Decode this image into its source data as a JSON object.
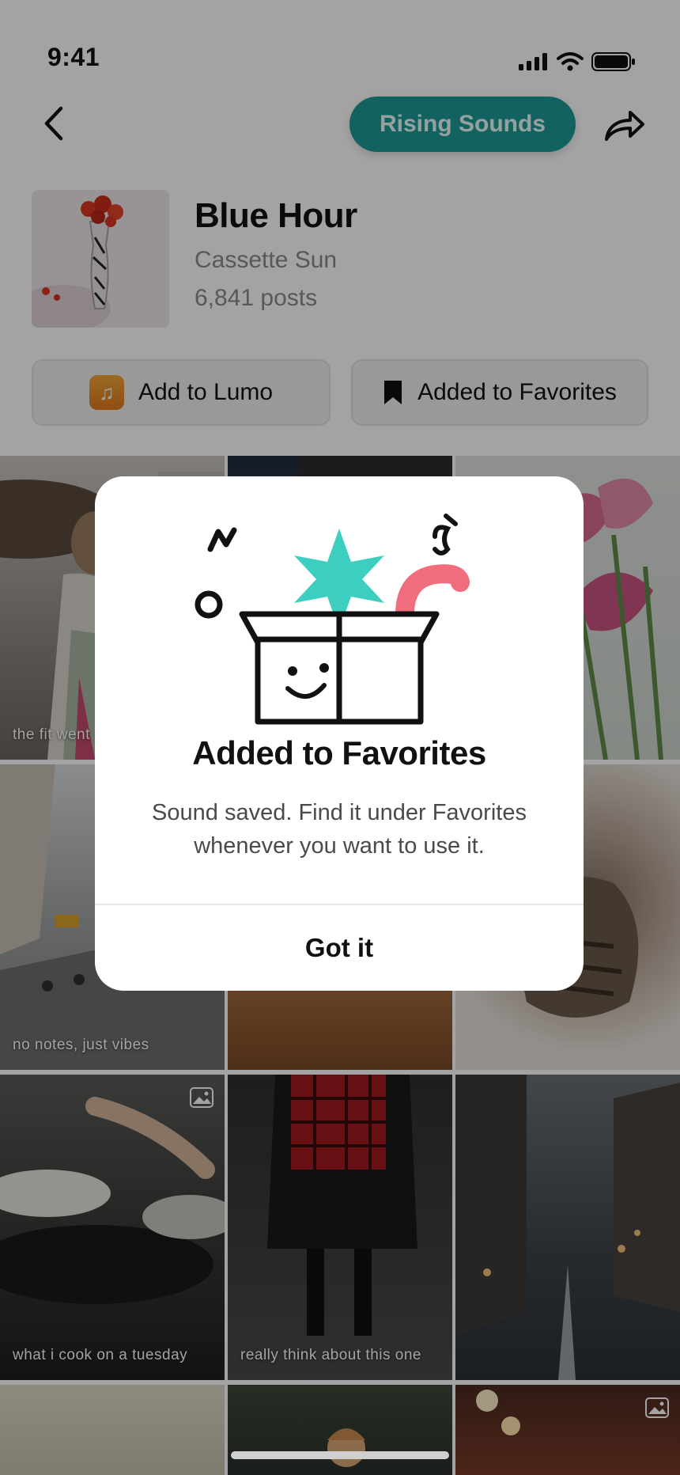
{
  "status_bar": {
    "time": "9:41",
    "icons": [
      "signal-icon",
      "wifi-icon",
      "battery-icon"
    ]
  },
  "nav": {
    "pill_label": "Rising Sounds",
    "back_icon": "chevron-left-icon",
    "share_icon": "share-arrow-icon"
  },
  "track": {
    "title": "Blue Hour",
    "artist": "Cassette Sun",
    "posts": "6,841 posts"
  },
  "actions": {
    "add_to_lumo": "Add to Lumo",
    "added_to_favorites": "Added to Favorites"
  },
  "grid": {
    "captions": [
      "the fit went",
      "no notes, just vibes",
      "what i cook on a tuesday",
      "really think about this one"
    ]
  },
  "modal": {
    "title": "Added to Favorites",
    "body": "Sound saved. Find it under Favorites whenever you want to use it.",
    "button": "Got it"
  },
  "colors": {
    "accent": "#1d9c95",
    "star": "#3ccfbf",
    "squiggle": "#f06d7e",
    "lumo": "#e88a25"
  }
}
